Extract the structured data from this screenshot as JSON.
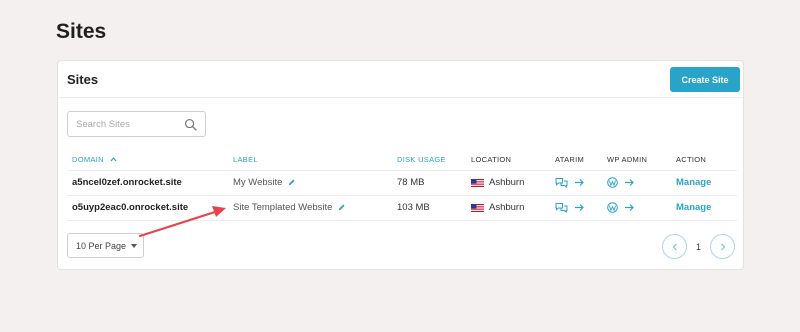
{
  "page": {
    "title": "Sites"
  },
  "card": {
    "title": "Sites",
    "create_label": "Create Site"
  },
  "search": {
    "placeholder": "Search Sites",
    "value": ""
  },
  "table": {
    "columns": {
      "domain": "DOMAIN",
      "label": "LABEL",
      "disk": "DISK USAGE",
      "location": "LOCATION",
      "atarim": "ATARIM",
      "wp_admin": "WP ADMIN",
      "action": "ACTION"
    },
    "sort": {
      "column": "domain",
      "direction": "ascending"
    },
    "rows": [
      {
        "domain": "a5ncel0zef.onrocket.site",
        "label": "My Website",
        "disk": "78 MB",
        "location": "Ashburn",
        "action": "Manage"
      },
      {
        "domain": "o5uyp2eac0.onrocket.site",
        "label": "Site Templated Website",
        "disk": "103 MB",
        "location": "Ashburn",
        "action": "Manage"
      }
    ]
  },
  "pagination": {
    "per_page": "10 Per Page",
    "current_page": "1"
  },
  "icons": {
    "search": "search-icon",
    "edit": "pencil-icon",
    "flag": "us-flag-icon",
    "chat": "chat-bubbles-icon",
    "wordpress": "wordpress-icon",
    "arrow": "arrow-right-icon",
    "sort": "chevron-up-icon",
    "prev": "chevron-left-icon",
    "next": "chevron-right-icon",
    "caret": "caret-down-icon"
  },
  "colors": {
    "accent": "#2aa3c9",
    "annotation_arrow": "#e8424f",
    "background": "#f3f0ef"
  }
}
